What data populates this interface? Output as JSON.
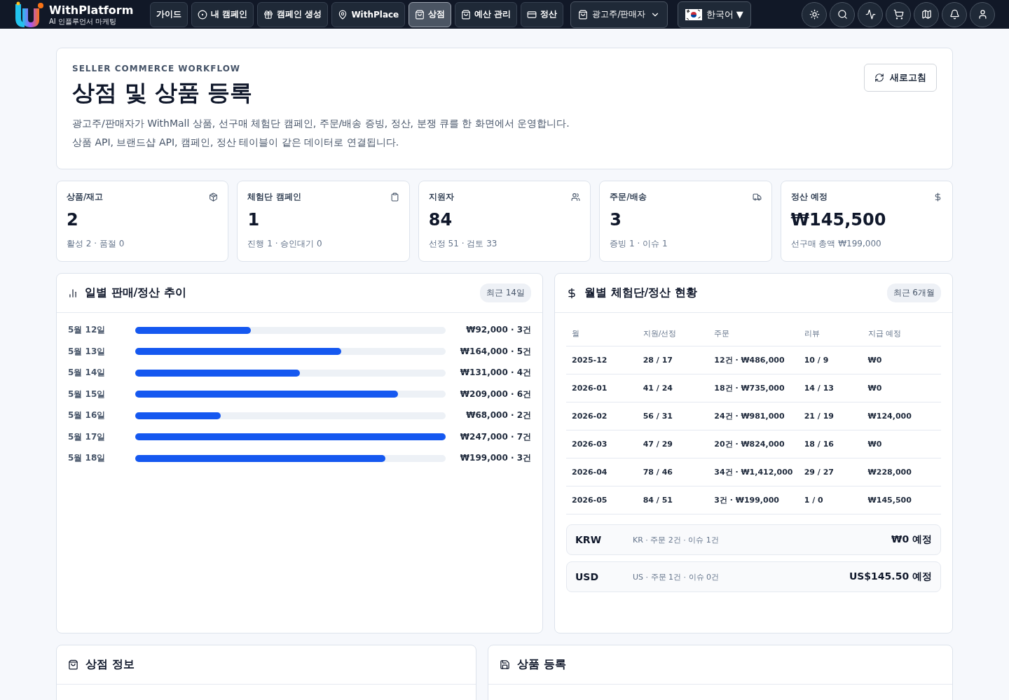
{
  "brand": {
    "name": "WithPlatform",
    "tagline": "AI 인플루언서 마케팅"
  },
  "nav": [
    {
      "label": "가이드",
      "selected": false
    },
    {
      "label": "내 캠페인",
      "selected": false
    },
    {
      "label": "캠페인 생성",
      "selected": false
    },
    {
      "label": "WithPlace",
      "selected": false
    },
    {
      "label": "상점",
      "selected": true
    },
    {
      "label": "예산 관리",
      "selected": false
    },
    {
      "label": "정산",
      "selected": false
    }
  ],
  "role_select": {
    "value": "광고주/판매자"
  },
  "language": {
    "value": "한국어",
    "caret": "▼"
  },
  "header": {
    "eyebrow": "SELLER COMMERCE WORKFLOW",
    "title": "상점 및 상품 등록",
    "lines": [
      "광고주/판매자가 WithMall 상품, 선구매 체험단 캠페인, 주문/배송 증빙, 정산, 분쟁 큐를 한 화면에서 운영합니다.",
      "상품 API, 브랜드샵 API, 캠페인, 정산 테이블이 같은 데이터로 연결됩니다."
    ],
    "refresh": "새로고침"
  },
  "stats": [
    {
      "label": "상품/재고",
      "value": "2",
      "note": "활성 2 · 품절 0"
    },
    {
      "label": "체험단 캠페인",
      "value": "1",
      "note": "진행 1 · 승인대기 0"
    },
    {
      "label": "지원자",
      "value": "84",
      "note": "선정 51 · 검토 33"
    },
    {
      "label": "주문/배송",
      "value": "3",
      "note": "증빙 1 · 이슈 1"
    },
    {
      "label": "정산 예정",
      "value": "₩145,500",
      "note": "선구매 총액 ₩199,000"
    }
  ],
  "daily": {
    "title": "일별 판매/정산 추이",
    "badge": "최근 14일",
    "rows": [
      {
        "date": "5월 12일",
        "level": 0.372,
        "reading": "₩92,000 · 3건"
      },
      {
        "date": "5월 13일",
        "level": 0.664,
        "reading": "₩164,000 · 5건"
      },
      {
        "date": "5월 14일",
        "level": 0.53,
        "reading": "₩131,000 · 4건"
      },
      {
        "date": "5월 15일",
        "level": 0.846,
        "reading": "₩209,000 · 6건"
      },
      {
        "date": "5월 16일",
        "level": 0.275,
        "reading": "₩68,000 · 2건"
      },
      {
        "date": "5월 17일",
        "level": 1,
        "reading": "₩247,000 · 7건"
      },
      {
        "date": "5월 18일",
        "level": 0.806,
        "reading": "₩199,000 · 3건"
      }
    ]
  },
  "monthly": {
    "title": "월별 체험단/정산 현황",
    "badge": "최근 6개월",
    "columns": [
      "월",
      "지원/선정",
      "주문",
      "리뷰",
      "지급 예정"
    ],
    "rows": [
      [
        "2025-12",
        "28 / 17",
        "12건 · ₩486,000",
        "10 / 9",
        "₩0"
      ],
      [
        "2026-01",
        "41 / 24",
        "18건 · ₩735,000",
        "14 / 13",
        "₩0"
      ],
      [
        "2026-02",
        "56 / 31",
        "24건 · ₩981,000",
        "21 / 19",
        "₩124,000"
      ],
      [
        "2026-03",
        "47 / 29",
        "20건 · ₩824,000",
        "18 / 16",
        "₩0"
      ],
      [
        "2026-04",
        "78 / 46",
        "34건 · ₩1,412,000",
        "29 / 27",
        "₩228,000"
      ],
      [
        "2026-05",
        "84 / 51",
        "3건 · ₩199,000",
        "1 / 0",
        "₩145,500"
      ]
    ],
    "currencies": [
      {
        "code": "KRW",
        "detail": "KR · 주문 2건 · 이슈 1건",
        "amount": "₩0 예정"
      },
      {
        "code": "USD",
        "detail": "US · 주문 1건 · 이슈 0건",
        "amount": "US$145.50 예정"
      }
    ]
  },
  "store_panel": {
    "title": "상점 정보"
  },
  "product_panel": {
    "title": "상품 등록"
  }
}
